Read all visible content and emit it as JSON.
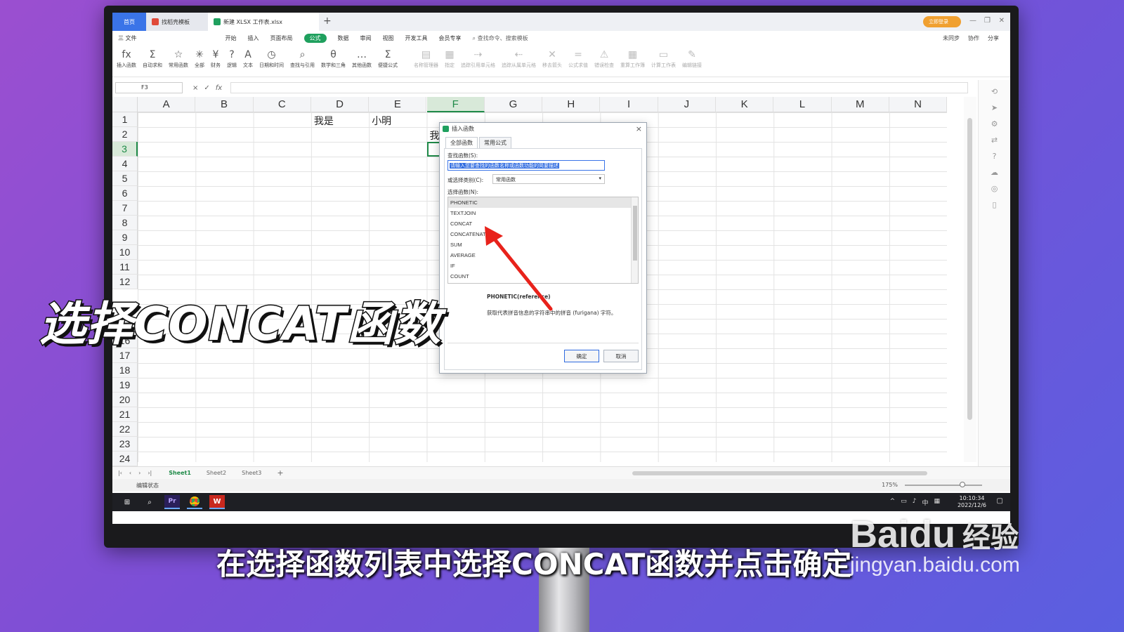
{
  "titlebar": {
    "home_tab": "首页",
    "template_tab": "找稻壳模板",
    "file_tab": "新建 XLSX 工作表.xlsx",
    "add_tab": "+",
    "login": "立即登录"
  },
  "menubar": {
    "items": [
      "三 文件",
      "开始",
      "插入",
      "页面布局",
      "公式",
      "数据",
      "审阅",
      "视图",
      "开发工具",
      "会员专享"
    ],
    "active": "公式",
    "search": "查找命令、搜索模板",
    "right": [
      "未同步",
      "协作",
      "分享"
    ]
  },
  "ribbon": {
    "groups": [
      {
        "icon": "fx",
        "label": "插入函数"
      },
      {
        "icon": "Σ",
        "label": "自动求和"
      },
      {
        "icon": "☆",
        "label": "常用函数"
      },
      {
        "icon": "✳",
        "label": "全部"
      },
      {
        "icon": "¥",
        "label": "财务"
      },
      {
        "icon": "?",
        "label": "逻辑"
      },
      {
        "icon": "A",
        "label": "文本"
      },
      {
        "icon": "◷",
        "label": "日期和时间"
      },
      {
        "icon": "⌕",
        "label": "查找与引用"
      },
      {
        "icon": "θ",
        "label": "数学和三角"
      },
      {
        "icon": "…",
        "label": "其他函数"
      },
      {
        "icon": "Σ",
        "label": "便捷公式"
      },
      {
        "icon": "▤",
        "label": "名称管理器"
      },
      {
        "icon": "▦",
        "label": "指定"
      },
      {
        "icon": "⇢",
        "label": "追踪引用单元格"
      },
      {
        "icon": "⇠",
        "label": "追踪从属单元格"
      },
      {
        "icon": "✕",
        "label": "移去箭头"
      },
      {
        "icon": "=",
        "label": "公式求值"
      },
      {
        "icon": "⚠",
        "label": "错误检查"
      },
      {
        "icon": "▦",
        "label": "重算工作簿"
      },
      {
        "icon": "▭",
        "label": "计算工作表"
      },
      {
        "icon": "✎",
        "label": "编辑链接"
      }
    ]
  },
  "formula_bar": {
    "name_box": "F3",
    "cancel": "×",
    "confirm": "✓",
    "fx": "fx"
  },
  "grid": {
    "columns": [
      "A",
      "B",
      "C",
      "D",
      "E",
      "F",
      "G",
      "H",
      "I",
      "J",
      "K",
      "L",
      "M",
      "N"
    ],
    "rows": [
      "1",
      "2",
      "3",
      "4",
      "5",
      "6",
      "7",
      "8",
      "9",
      "10",
      "11",
      "12",
      "13",
      "14",
      "15",
      "16",
      "17",
      "18",
      "19",
      "20",
      "21",
      "22",
      "23",
      "24"
    ],
    "selected_column": "F",
    "selected_row": "3",
    "cells": {
      "D1": "我是",
      "E1": "小明",
      "F2": "我"
    }
  },
  "sheets": {
    "tabs": [
      "Sheet1",
      "Sheet2",
      "Sheet3"
    ],
    "active": "Sheet1",
    "add": "+"
  },
  "status": {
    "mode": "编辑状态",
    "zoom": "175%"
  },
  "taskbar": {
    "time": "10:10:34",
    "date": "2022/12/6",
    "ime": "中"
  },
  "dialog": {
    "title": "插入函数",
    "close": "×",
    "tabs": [
      "全部函数",
      "常用公式"
    ],
    "active_tab": "全部函数",
    "search_label": "查找函数(S):",
    "search_value": "请输入您要查找的函数名称或函数功能的简要描述",
    "category_label": "或选择类别(C):",
    "category_value": "常用函数",
    "list_label": "选择函数(N):",
    "functions": [
      "PHONETIC",
      "TEXTJOIN",
      "CONCAT",
      "CONCATENATE",
      "SUM",
      "AVERAGE",
      "IF",
      "COUNT"
    ],
    "selected_function": "PHONETIC",
    "desc_signature": "PHONETIC(reference)",
    "desc_text": "获取代表拼音信息的字符串中的拼音 (furigana) 字符。",
    "ok": "确定",
    "cancel": "取消"
  },
  "annotation": {
    "arrow_color": "#e8221b"
  },
  "overlay": {
    "big_caption": "选择CONCAT函数",
    "sub_caption": "在选择函数列表中选择CONCAT函数并点击确定"
  },
  "watermark": {
    "logo": "Baidu",
    "brand": "经验",
    "url": "jingyan.baidu.com"
  }
}
